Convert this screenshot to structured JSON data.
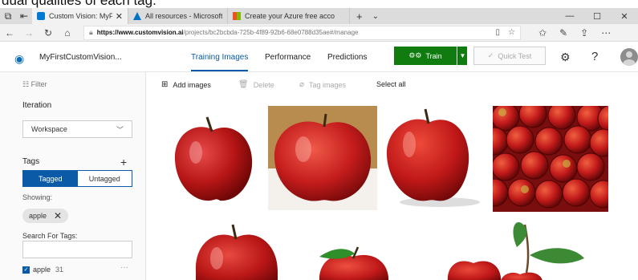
{
  "caption": "dual qualities of each tag.",
  "browser": {
    "tabs": [
      {
        "title": "Custom Vision: MyFirst",
        "close": "✕"
      },
      {
        "title": "All resources - Microsoft Az",
        "close": ""
      },
      {
        "title": "Create your Azure free acco",
        "close": ""
      }
    ],
    "new_tab": "+",
    "tab_menu": "⌄",
    "url_host": "https://www.customvision.ai",
    "url_path": "/projects/bc2bcbda-725b-4f89-92b6-68e0788d35ae#/manage",
    "window_controls": [
      "—",
      "☐",
      "✕"
    ]
  },
  "app": {
    "project_name": "MyFirstCustomVision...",
    "nav": [
      "Training Images",
      "Performance",
      "Predictions"
    ],
    "train_label": "Train",
    "quick_test_label": "Quick Test"
  },
  "sidebar": {
    "filter_label": "Filter",
    "iteration_label": "Iteration",
    "iteration_value": "Workspace",
    "tags_label": "Tags",
    "tagged_label": "Tagged",
    "untagged_label": "Untagged",
    "showing_label": "Showing:",
    "chip_label": "apple",
    "search_label": "Search For Tags:",
    "search_value": "",
    "tag_name": "apple",
    "tag_count": "31",
    "tag_more": "···"
  },
  "toolbar": {
    "add_images": "Add images",
    "delete": "Delete",
    "tag_images": "Tag images",
    "select_all": "Select all"
  },
  "colors": {
    "accent_blue": "#0a5aa8",
    "train_green": "#107c10",
    "apple_red": "#c21a1a"
  }
}
